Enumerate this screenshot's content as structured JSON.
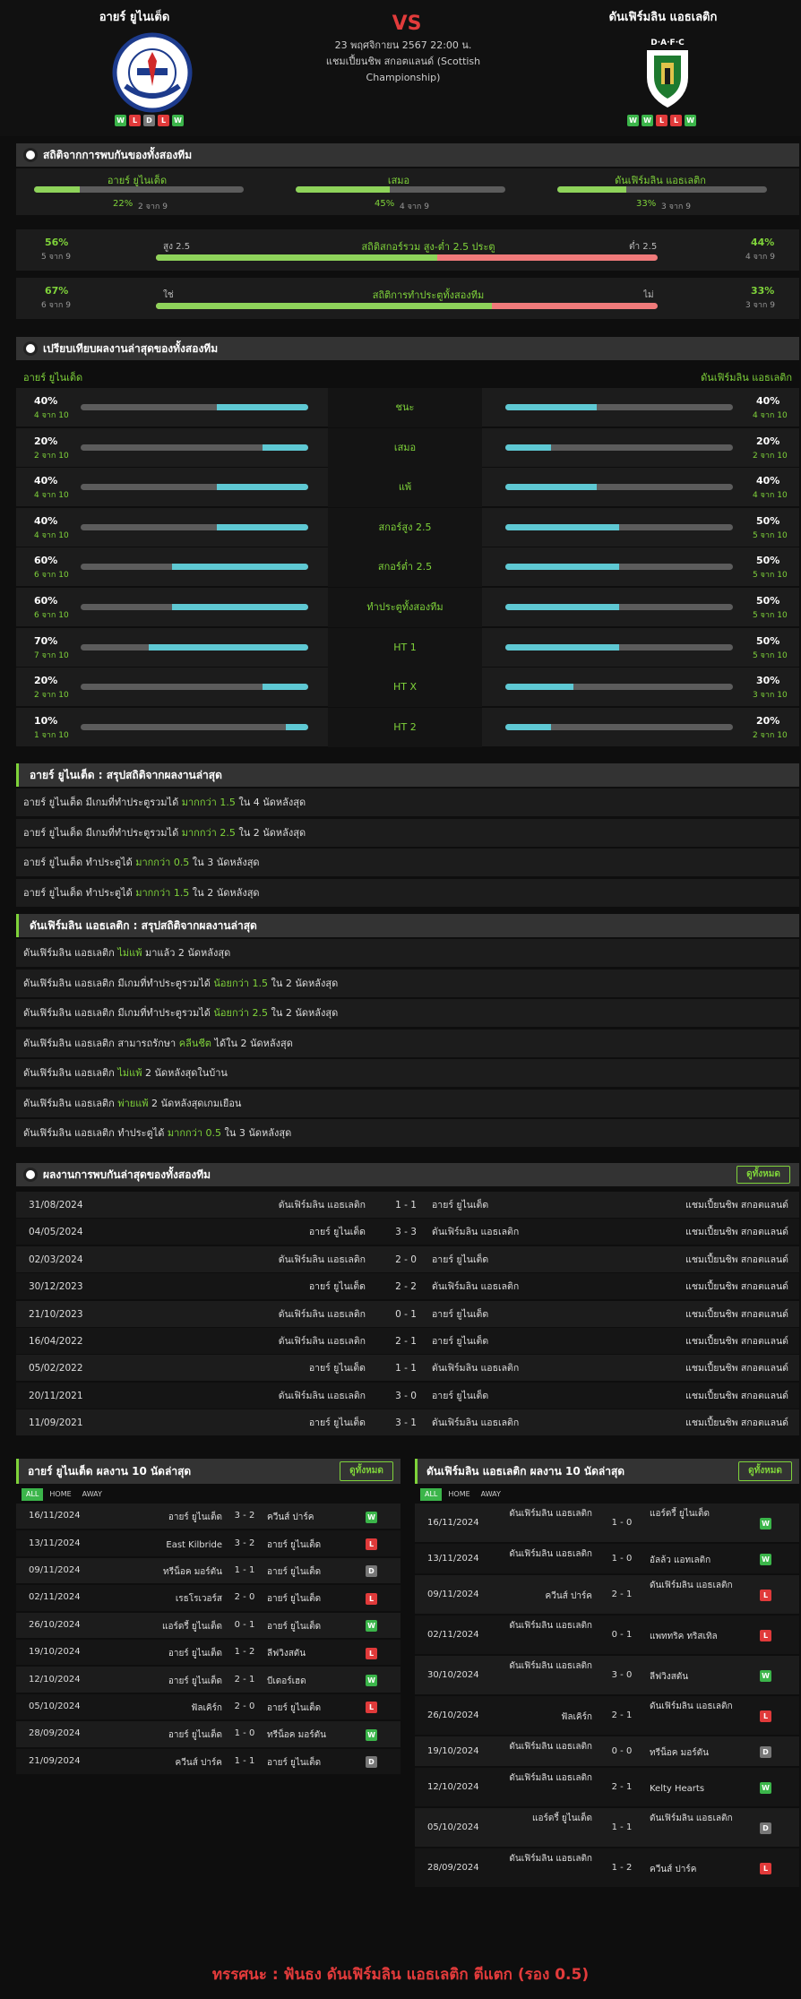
{
  "header": {
    "home": "อายร์ ยูไนเต็ด",
    "away": "ดันเฟิร์มลิน แอธเลติก",
    "vs": "VS",
    "date": "23 พฤศจิกายน 2567 22:00 น.",
    "league": "แชมเปี้ยนชิพ สกอตแลนด์ (Scottish Championship)",
    "home_form": [
      "W",
      "L",
      "D",
      "L",
      "W"
    ],
    "away_form": [
      "W",
      "W",
      "L",
      "L",
      "W"
    ],
    "home_logo_text": "THE HONEST MEN",
    "away_logo_text": "D·A·F·C"
  },
  "h2h_stats": {
    "title": "สถิติจากการพบกันของทั้งสองทีม",
    "cols": [
      {
        "label": "อายร์ ยูไนเต็ด",
        "pct": "22%",
        "sub": "2 จาก 9",
        "v": 0.22
      },
      {
        "label": "เสมอ",
        "pct": "45%",
        "sub": "4 จาก 9",
        "v": 0.45
      },
      {
        "label": "ดันเฟิร์มลิน แอธเลติก",
        "pct": "33%",
        "sub": "3 จาก 9",
        "v": 0.33
      }
    ],
    "ou": {
      "left_pct": "56%",
      "left_sub": "5 จาก 9",
      "left_label": "สูง 2.5",
      "title": "สถิติสกอร์รวม สูง-ต่ำ 2.5 ประตู",
      "right_label": "ต่ำ 2.5",
      "right_pct": "44%",
      "right_sub": "4 จาก 9",
      "v": 0.56
    },
    "btts": {
      "left_pct": "67%",
      "left_sub": "6 จาก 9",
      "left_label": "ใช่",
      "title": "สถิติการทำประตูทั้งสองทีม",
      "right_label": "ไม่",
      "right_pct": "33%",
      "right_sub": "3 จาก 9",
      "v": 0.67
    }
  },
  "compare": {
    "title": "เปรียบเทียบผลงานล่าสุดของทั้งสองทีม",
    "home": "อายร์ ยูไนเต็ด",
    "away": "ดันเฟิร์มลิน แอธเลติก",
    "rows": [
      {
        "label": "ชนะ",
        "lp": "40%",
        "ls": "4 จาก 10",
        "lv": 0.4,
        "rp": "40%",
        "rs": "4 จาก 10",
        "rv": 0.4
      },
      {
        "label": "เสมอ",
        "lp": "20%",
        "ls": "2 จาก 10",
        "lv": 0.2,
        "rp": "20%",
        "rs": "2 จาก 10",
        "rv": 0.2
      },
      {
        "label": "แพ้",
        "lp": "40%",
        "ls": "4 จาก 10",
        "lv": 0.4,
        "rp": "40%",
        "rs": "4 จาก 10",
        "rv": 0.4
      },
      {
        "label": "สกอร์สูง 2.5",
        "lp": "40%",
        "ls": "4 จาก 10",
        "lv": 0.4,
        "rp": "50%",
        "rs": "5 จาก 10",
        "rv": 0.5
      },
      {
        "label": "สกอร์ต่ำ 2.5",
        "lp": "60%",
        "ls": "6 จาก 10",
        "lv": 0.6,
        "rp": "50%",
        "rs": "5 จาก 10",
        "rv": 0.5
      },
      {
        "label": "ทำประตูทั้งสองทีม",
        "lp": "60%",
        "ls": "6 จาก 10",
        "lv": 0.6,
        "rp": "50%",
        "rs": "5 จาก 10",
        "rv": 0.5
      },
      {
        "label": "HT 1",
        "lp": "70%",
        "ls": "7 จาก 10",
        "lv": 0.7,
        "rp": "50%",
        "rs": "5 จาก 10",
        "rv": 0.5
      },
      {
        "label": "HT X",
        "lp": "20%",
        "ls": "2 จาก 10",
        "lv": 0.2,
        "rp": "30%",
        "rs": "3 จาก 10",
        "rv": 0.3
      },
      {
        "label": "HT 2",
        "lp": "10%",
        "ls": "1 จาก 10",
        "lv": 0.1,
        "rp": "20%",
        "rs": "2 จาก 10",
        "rv": 0.2
      }
    ]
  },
  "home_summary": {
    "title": "อายร์ ยูไนเต็ด : สรุปสถิติจากผลงานล่าสุด",
    "items": [
      [
        "อายร์ ยูไนเต็ด  มีเกมที่ทำประตูรวมได้ ",
        "มากกว่า  1.5",
        " ใน 4 นัดหลังสุด"
      ],
      [
        "อายร์ ยูไนเต็ด  มีเกมที่ทำประตูรวมได้ ",
        "มากกว่า  2.5",
        " ใน 2 นัดหลังสุด"
      ],
      [
        "อายร์ ยูไนเต็ด  ทำประตูได้ ",
        "มากกว่า  0.5",
        " ใน 3 นัดหลังสุด"
      ],
      [
        "อายร์ ยูไนเต็ด  ทำประตูได้ ",
        "มากกว่า  1.5",
        " ใน 2 นัดหลังสุด"
      ]
    ]
  },
  "away_summary": {
    "title": "ดันเฟิร์มลิน แอธเลติก : สรุปสถิติจากผลงานล่าสุด",
    "items": [
      [
        "ดันเฟิร์มลิน แอธเลติก ",
        "ไม่แพ้",
        " มาแล้ว 2 นัดหลังสุด"
      ],
      [
        "ดันเฟิร์มลิน แอธเลติก  มีเกมที่ทำประตูรวมได้ ",
        "น้อยกว่า  1.5",
        " ใน 2 นัดหลังสุด"
      ],
      [
        "ดันเฟิร์มลิน แอธเลติก  มีเกมที่ทำประตูรวมได้ ",
        "น้อยกว่า  2.5",
        " ใน 2 นัดหลังสุด"
      ],
      [
        "ดันเฟิร์มลิน แอธเลติก  สามารถรักษา ",
        "คลีนชีต",
        " ได้ใน 2 นัดหลังสุด"
      ],
      [
        "ดันเฟิร์มลิน แอธเลติก ",
        "ไม่แพ้",
        " 2  นัดหลังสุดในบ้าน"
      ],
      [
        "ดันเฟิร์มลิน แอธเลติก ",
        "พ่ายแพ้",
        " 2  นัดหลังสุดเกมเยือน"
      ],
      [
        "ดันเฟิร์มลิน แอธเลติก  ทำประตูได้ ",
        "มากกว่า  0.5",
        " ใน 3 นัดหลังสุด"
      ]
    ]
  },
  "h2h_results": {
    "title": "ผลงานการพบกันล่าสุดของทั้งสองทีม",
    "more": "ดูทั้งหมด",
    "rows": [
      [
        "31/08/2024",
        "ดันเฟิร์มลิน แอธเลติก",
        "1 - 1",
        "อายร์ ยูไนเต็ด",
        "แชมเปี้ยนชิพ สกอตแลนด์"
      ],
      [
        "04/05/2024",
        "อายร์ ยูไนเต็ด",
        "3 - 3",
        "ดันเฟิร์มลิน แอธเลติก",
        "แชมเปี้ยนชิพ สกอตแลนด์"
      ],
      [
        "02/03/2024",
        "ดันเฟิร์มลิน แอธเลติก",
        "2 - 0",
        "อายร์ ยูไนเต็ด",
        "แชมเปี้ยนชิพ สกอตแลนด์"
      ],
      [
        "30/12/2023",
        "อายร์ ยูไนเต็ด",
        "2 - 2",
        "ดันเฟิร์มลิน แอธเลติก",
        "แชมเปี้ยนชิพ สกอตแลนด์"
      ],
      [
        "21/10/2023",
        "ดันเฟิร์มลิน แอธเลติก",
        "0 - 1",
        "อายร์ ยูไนเต็ด",
        "แชมเปี้ยนชิพ สกอตแลนด์"
      ],
      [
        "16/04/2022",
        "ดันเฟิร์มลิน แอธเลติก",
        "2 - 1",
        "อายร์ ยูไนเต็ด",
        "แชมเปี้ยนชิพ สกอตแลนด์"
      ],
      [
        "05/02/2022",
        "อายร์ ยูไนเต็ด",
        "1 - 1",
        "ดันเฟิร์มลิน แอธเลติก",
        "แชมเปี้ยนชิพ สกอตแลนด์"
      ],
      [
        "20/11/2021",
        "ดันเฟิร์มลิน แอธเลติก",
        "3 - 0",
        "อายร์ ยูไนเต็ด",
        "แชมเปี้ยนชิพ สกอตแลนด์"
      ],
      [
        "11/09/2021",
        "อายร์ ยูไนเต็ด",
        "3 - 1",
        "ดันเฟิร์มลิน แอธเลติก",
        "แชมเปี้ยนชิพ สกอตแลนด์"
      ]
    ]
  },
  "home_last10": {
    "title": "อายร์ ยูไนเต็ด ผลงาน 10 นัดล่าสุด",
    "more": "ดูทั้งหมด",
    "tabs": [
      "ALL",
      "HOME",
      "AWAY"
    ],
    "rows": [
      [
        "16/11/2024",
        "อายร์ ยูไนเต็ด",
        "3 - 2",
        "ควีนส์ ปาร์ค",
        "W"
      ],
      [
        "13/11/2024",
        "East Kilbride",
        "3 - 2",
        "อายร์ ยูไนเต็ด",
        "L"
      ],
      [
        "09/11/2024",
        "ทรีน็อค มอร์ตัน",
        "1 - 1",
        "อายร์ ยูไนเต็ด",
        "D"
      ],
      [
        "02/11/2024",
        "เรธโรเวอร์ส",
        "2 - 0",
        "อายร์ ยูไนเต็ด",
        "L"
      ],
      [
        "26/10/2024",
        "แอร์ดรี้ ยูไนเต็ด",
        "0 - 1",
        "อายร์ ยูไนเต็ด",
        "W"
      ],
      [
        "19/10/2024",
        "อายร์ ยูไนเต็ด",
        "1 - 2",
        "ลีฟวิงสตัน",
        "L"
      ],
      [
        "12/10/2024",
        "อายร์ ยูไนเต็ด",
        "2 - 1",
        "บีเดอร์เฮด",
        "W"
      ],
      [
        "05/10/2024",
        "ฟัลเคิร์ก",
        "2 - 0",
        "อายร์ ยูไนเต็ด",
        "L"
      ],
      [
        "28/09/2024",
        "อายร์ ยูไนเต็ด",
        "1 - 0",
        "ทรีน็อค มอร์ตัน",
        "W"
      ],
      [
        "21/09/2024",
        "ควีนส์ ปาร์ค",
        "1 - 1",
        "อายร์ ยูไนเต็ด",
        "D"
      ]
    ]
  },
  "away_last10": {
    "title": "ดันเฟิร์มลิน แอธเลติก ผลงาน 10 นัดล่าสุด",
    "more": "ดูทั้งหมด",
    "tabs": [
      "ALL",
      "HOME",
      "AWAY"
    ],
    "rows": [
      [
        "16/11/2024",
        "ดันเฟิร์มลิน แอธเลติก",
        "1 - 0",
        "แอร์ดรี้ ยูไนเต็ด",
        "W"
      ],
      [
        "13/11/2024",
        "ดันเฟิร์มลิน แอธเลติก",
        "1 - 0",
        "อัลล้ว แอทเลติก",
        "W"
      ],
      [
        "09/11/2024",
        "ควีนส์ ปาร์ค",
        "2 - 1",
        "ดันเฟิร์มลิน แอธเลติก",
        "L"
      ],
      [
        "02/11/2024",
        "ดันเฟิร์มลิน แอธเลติก",
        "0 - 1",
        "แพททริค ทริสเทิล",
        "L"
      ],
      [
        "30/10/2024",
        "ดันเฟิร์มลิน แอธเลติก",
        "3 - 0",
        "ลีฟวิงสตัน",
        "W"
      ],
      [
        "26/10/2024",
        "ฟัลเคิร์ก",
        "2 - 1",
        "ดันเฟิร์มลิน แอธเลติก",
        "L"
      ],
      [
        "19/10/2024",
        "ดันเฟิร์มลิน แอธเลติก",
        "0 - 0",
        "ทรีน็อค มอร์ตัน",
        "D"
      ],
      [
        "12/10/2024",
        "ดันเฟิร์มลิน แอธเลติก",
        "2 - 1",
        "Kelty Hearts",
        "W"
      ],
      [
        "05/10/2024",
        "แอร์ดรี้ ยูไนเต็ด",
        "1 - 1",
        "ดันเฟิร์มลิน แอธเลติก",
        "D"
      ],
      [
        "28/09/2024",
        "ดันเฟิร์มลิน แอธเลติก",
        "1 - 2",
        "ควีนส์ ปาร์ค",
        "L"
      ]
    ]
  },
  "prediction": {
    "label": "ทรรศนะ",
    "sep": " : ",
    "text": " ฟันธง ดันเฟิร์มลิน แอธเลติก ตีแตก (รอง 0.5)"
  },
  "colors": {
    "green": "#7fd33a",
    "red": "#e23b3b",
    "cyan": "#5ec8d3",
    "bar_win": "#8ed35a",
    "bar_loss": "#f07a7a"
  }
}
